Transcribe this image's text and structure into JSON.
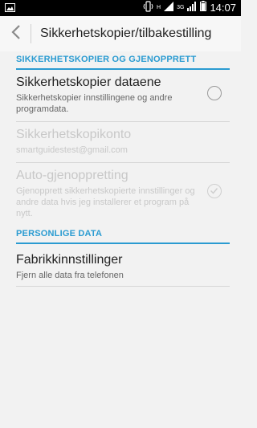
{
  "status_bar": {
    "time": "14:07",
    "network_top": "H",
    "network_bottom": "3G"
  },
  "action_bar": {
    "title": "Sikkerhetskopier/tilbakestilling"
  },
  "sections": {
    "backup_header": "SIKKERHETSKOPIER OG GJENOPPRETT",
    "personal_header": "PERSONLIGE DATA"
  },
  "items": {
    "backup_data": {
      "title": "Sikkerhetskopier dataene",
      "summary": "Sikkerhetskopier innstillingene og andre programdata.",
      "checked": false
    },
    "backup_account": {
      "title": "Sikkerhetskopikonto",
      "summary": "smartguidestest@gmail.com"
    },
    "auto_restore": {
      "title": "Auto-gjenoppretting",
      "summary": "Gjenopprett sikkerhetskopierte innstillinger og andre data hvis jeg installerer et program på nytt.",
      "checked": true
    },
    "factory_reset": {
      "title": "Fabrikkinnstillinger",
      "summary": "Fjern alle data fra telefonen"
    }
  },
  "colors": {
    "accent": "#2a9bd1",
    "disabled_text": "#c8c8c8"
  }
}
